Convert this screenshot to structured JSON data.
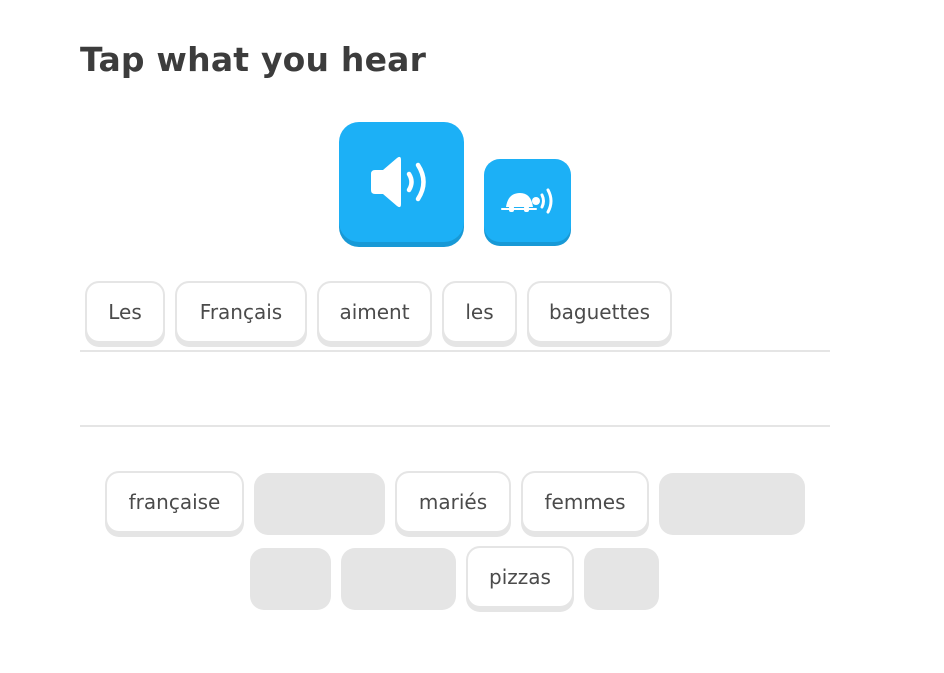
{
  "challenge": {
    "title": "Tap what you hear"
  },
  "audio": {
    "play_icon": "speaker-icon",
    "slow_icon": "turtle-speaker-icon",
    "color": "#1cb0f6"
  },
  "answer": {
    "tiles": [
      "Les",
      "Français",
      "aiment",
      "les",
      "baguettes"
    ]
  },
  "word_bank": {
    "row1": [
      "française",
      "",
      "mariés",
      "femmes",
      ""
    ],
    "row2": [
      "",
      "",
      "pizzas",
      ""
    ]
  },
  "colors": {
    "tile_border": "#e5e5e5",
    "used_slot": "#e5e5e5",
    "text": "#4b4b4b"
  }
}
